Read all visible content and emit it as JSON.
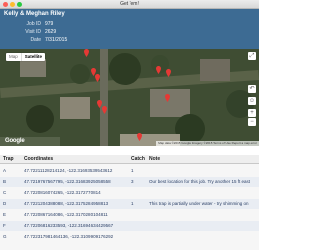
{
  "window": {
    "title": "Get 'em!"
  },
  "header": {
    "names": "Kelly & Meghan Riley",
    "job_id_label": "Job ID",
    "job_id": "979",
    "visit_id_label": "Visit ID",
    "visit_id": "2629",
    "date_label": "Date",
    "date": "7/31/2015"
  },
  "map": {
    "map_label": "Map",
    "satellite_label": "Satellite",
    "selected_type": "Satellite",
    "fullscreen_icon": "fullscreen-icon",
    "attribution": "Map data ©2015 Google Imagery ©2015  Terms of Use  Report a map error",
    "logo": "Google",
    "pin_color": "#e53935"
  },
  "table": {
    "headers": {
      "trap": "Trap",
      "coordinates": "Coordinates",
      "catch": "Catch",
      "note": "Note"
    },
    "rows": [
      {
        "trap": "A",
        "coordinates": "47.72211128214124, -122.31693539543612",
        "catch": "1",
        "note": ""
      },
      {
        "trap": "B",
        "coordinates": "47.7219767567795, -122.31683925058558",
        "catch": "3",
        "note": "Our best location for this job.  Try another 15 ft east"
      },
      {
        "trap": "C",
        "coordinates": "47.7220816074265, -122.3172770814",
        "catch": "",
        "note": ""
      },
      {
        "trap": "D",
        "coordinates": "47.7221204388088, -122.3175284958813",
        "catch": "1",
        "note": "This trap is partially under water - try shimming on"
      },
      {
        "trap": "E",
        "coordinates": "47.7220867164086, -122.3170280104811",
        "catch": "",
        "note": ""
      },
      {
        "trap": "F",
        "coordinates": "47.72206816233593, -122.31694634429567",
        "catch": "",
        "note": ""
      },
      {
        "trap": "G",
        "coordinates": "47.722317981464136, -122.3109909176292",
        "catch": "",
        "note": ""
      }
    ]
  }
}
